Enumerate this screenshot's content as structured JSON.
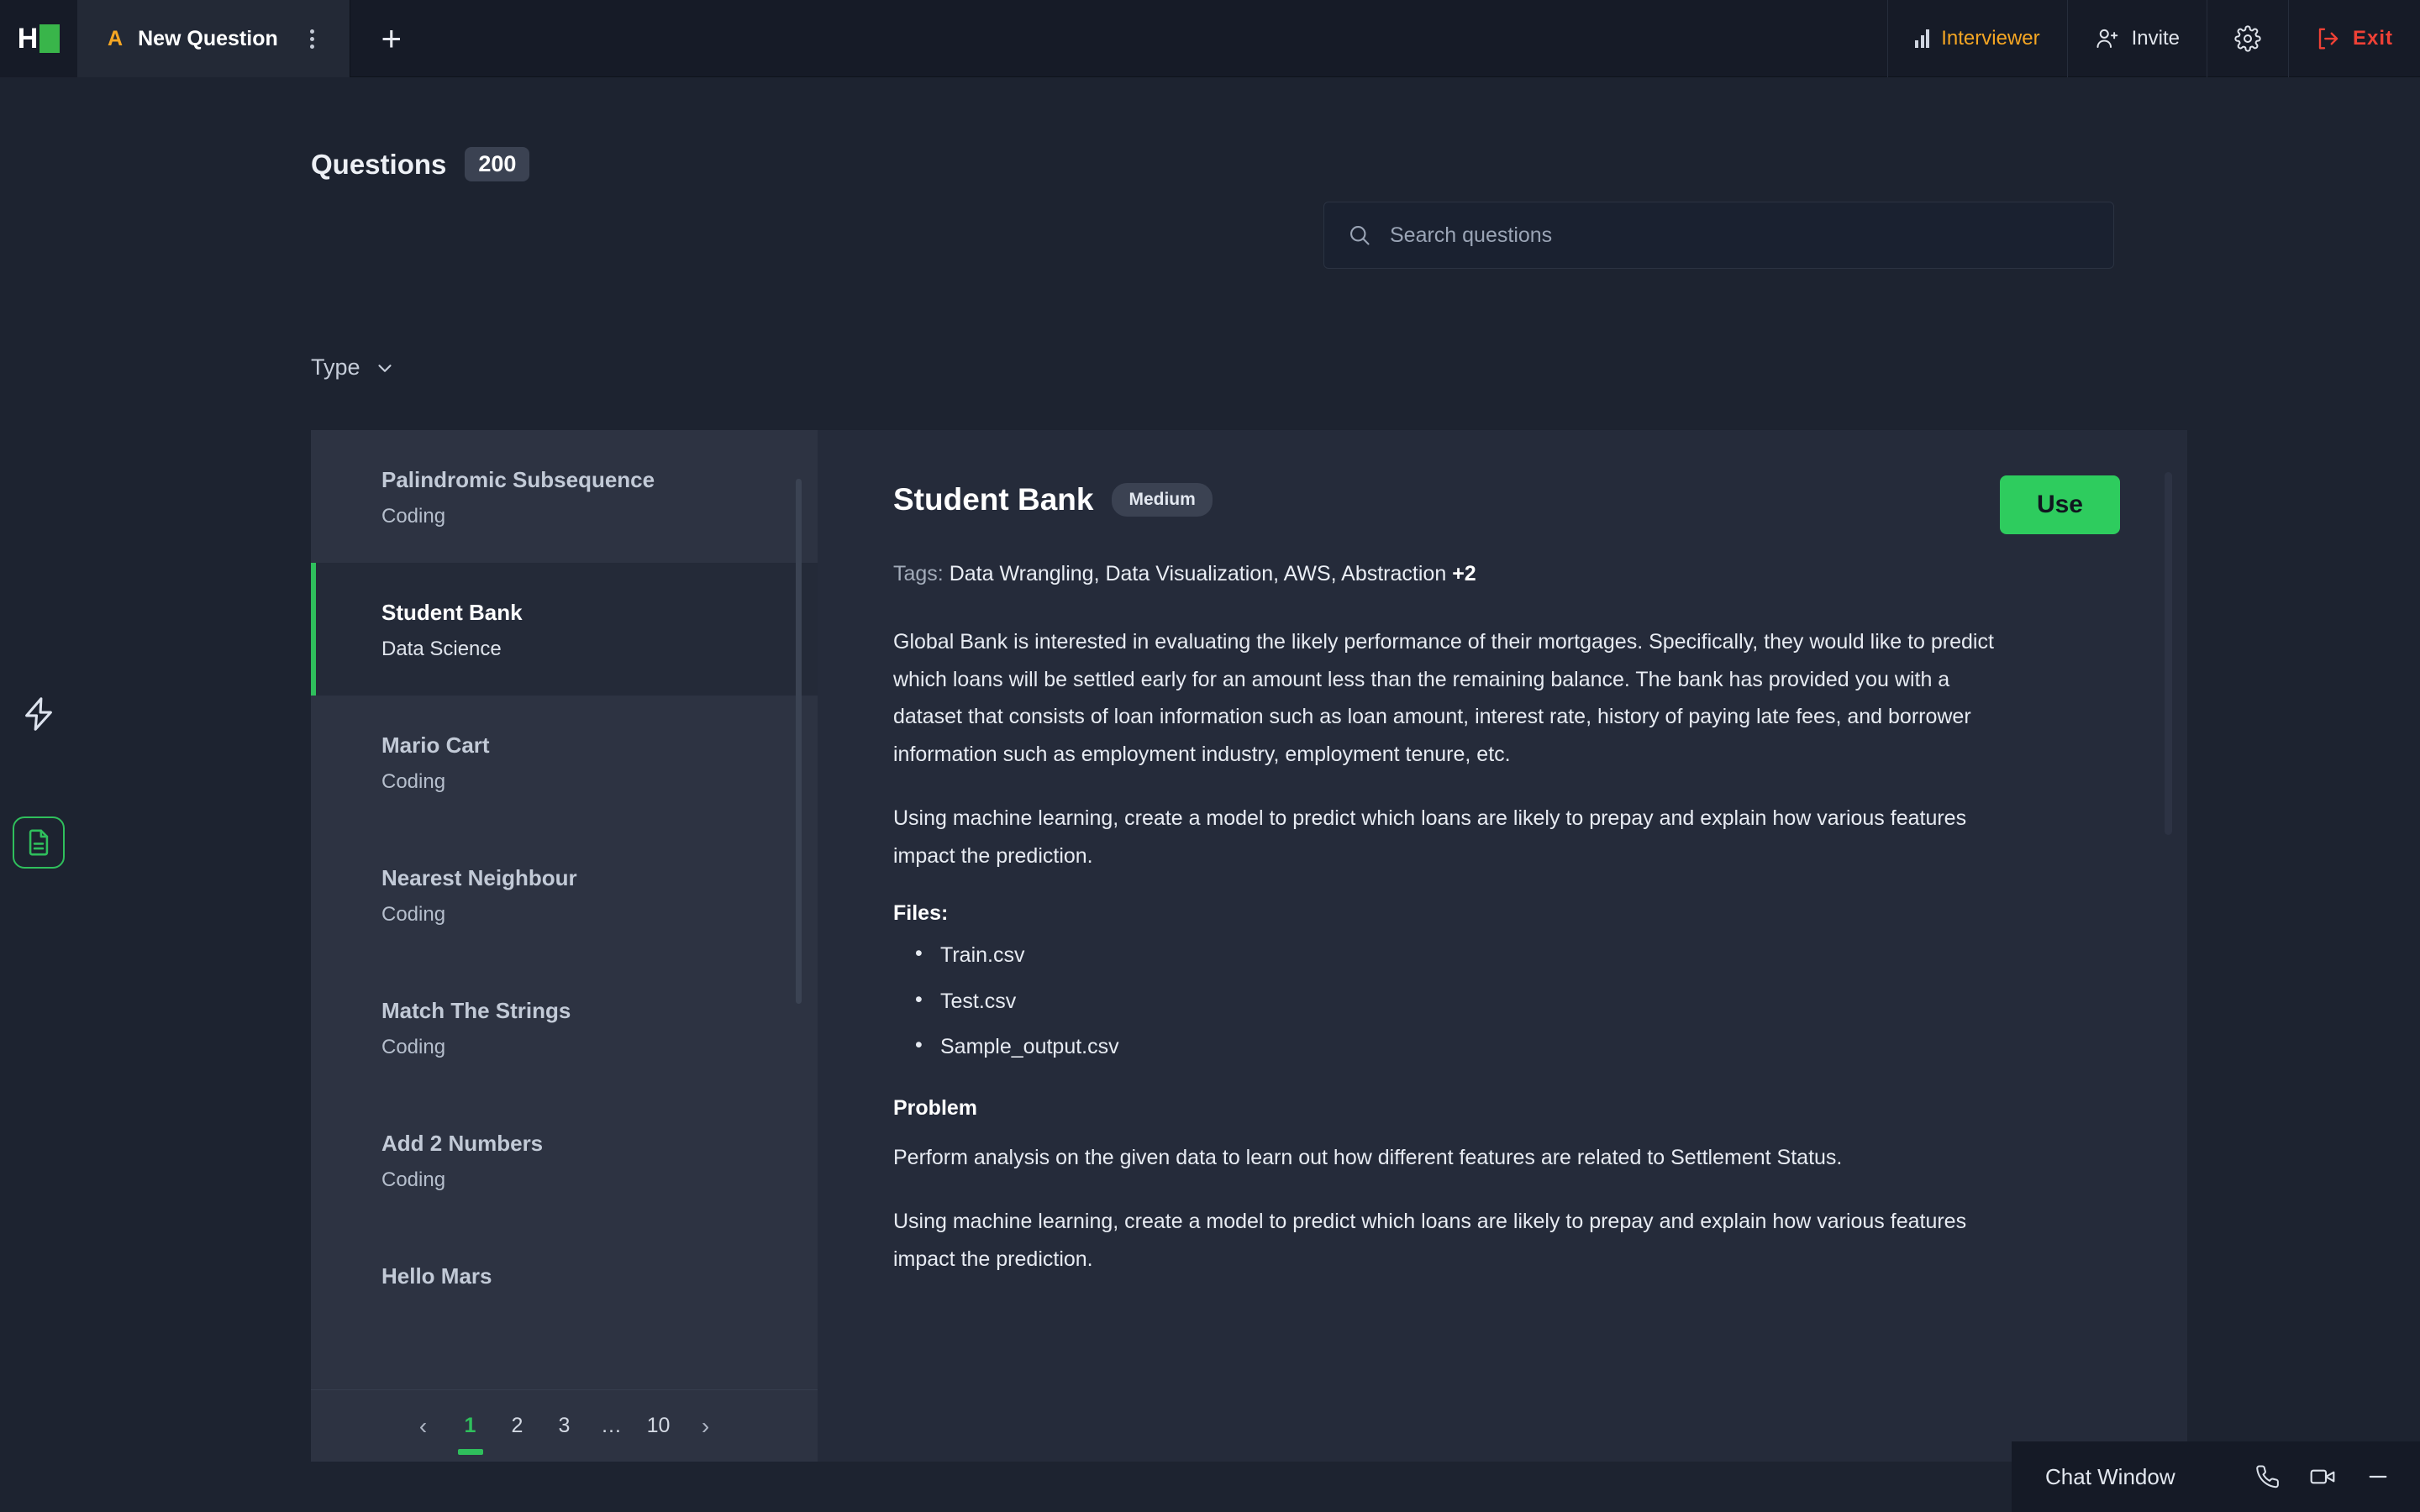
{
  "topbar": {
    "logo": "hackerrank-logo",
    "tab": {
      "avatar_letter": "A",
      "title": "New Question",
      "menu_icon": "kebab-menu-icon"
    },
    "add_tab_label": "+",
    "items": [
      {
        "label": "Interviewer",
        "icon": "bar-chart-icon"
      },
      {
        "label": "Invite",
        "icon": "user-add-icon"
      },
      {
        "label": "",
        "icon": "gear-icon"
      },
      {
        "label": "Exit",
        "icon": "exit-icon"
      }
    ]
  },
  "left_rail": {
    "bolt_icon": "lightning-bolt-icon",
    "doc_icon": "document-icon"
  },
  "page": {
    "title": "Questions",
    "count": "200"
  },
  "search": {
    "placeholder": "Search questions",
    "value": "",
    "icon": "search-icon"
  },
  "filters": {
    "type_label": "Type",
    "chevron": "chevron-down-icon"
  },
  "question_list": [
    {
      "name": "Palindromic Subsequence",
      "type": "Coding",
      "active": false
    },
    {
      "name": "Student Bank",
      "type": "Data Science",
      "active": true
    },
    {
      "name": "Mario Cart",
      "type": "Coding",
      "active": false
    },
    {
      "name": "Nearest Neighbour",
      "type": "Coding",
      "active": false
    },
    {
      "name": "Match The Strings",
      "type": "Coding",
      "active": false
    },
    {
      "name": "Add 2 Numbers",
      "type": "Coding",
      "active": false
    },
    {
      "name": "Hello Mars",
      "type": "",
      "active": false
    }
  ],
  "pagination": {
    "prev": "‹",
    "next": "›",
    "pages": [
      "1",
      "2",
      "3",
      "…",
      "10"
    ],
    "current": "1"
  },
  "detail": {
    "title": "Student Bank",
    "difficulty": "Medium",
    "use_button": "Use",
    "tags_label": "Tags:",
    "tags_value": "Data Wrangling, Data Visualization, AWS, Abstraction",
    "tags_more": "+2",
    "paragraph_1": "Global Bank is interested in evaluating the likely performance of their mortgages. Specifically, they would like to predict which loans will be settled early for an amount less than the remaining balance. The bank has provided you with a dataset that consists of loan information such as loan amount, interest rate, history of paying late fees, and borrower information such as employment industry, employment tenure, etc.",
    "paragraph_2": "Using machine learning, create a model to predict which loans are likely to prepay and explain how various features impact the prediction.",
    "files_heading": "Files:",
    "files": [
      "Train.csv",
      "Test.csv",
      "Sample_output.csv"
    ],
    "problem_heading": "Problem",
    "problem_paragraph_1": "Perform analysis on the given data to learn out how different features are related to Settlement Status.",
    "problem_paragraph_2": "Using machine learning, create a model to predict which loans are likely to prepay and explain how various features impact the prediction."
  },
  "chat": {
    "title": "Chat Window",
    "phone_icon": "phone-icon",
    "video_icon": "video-camera-icon",
    "minimize_icon": "minimize-icon"
  },
  "colors": {
    "accent_green": "#2fbf5c",
    "orange": "#f5A623",
    "red": "#ef4136",
    "page_bg": "#1d2330",
    "panel_bg": "#2d3342",
    "detail_bg": "#252b3a"
  }
}
